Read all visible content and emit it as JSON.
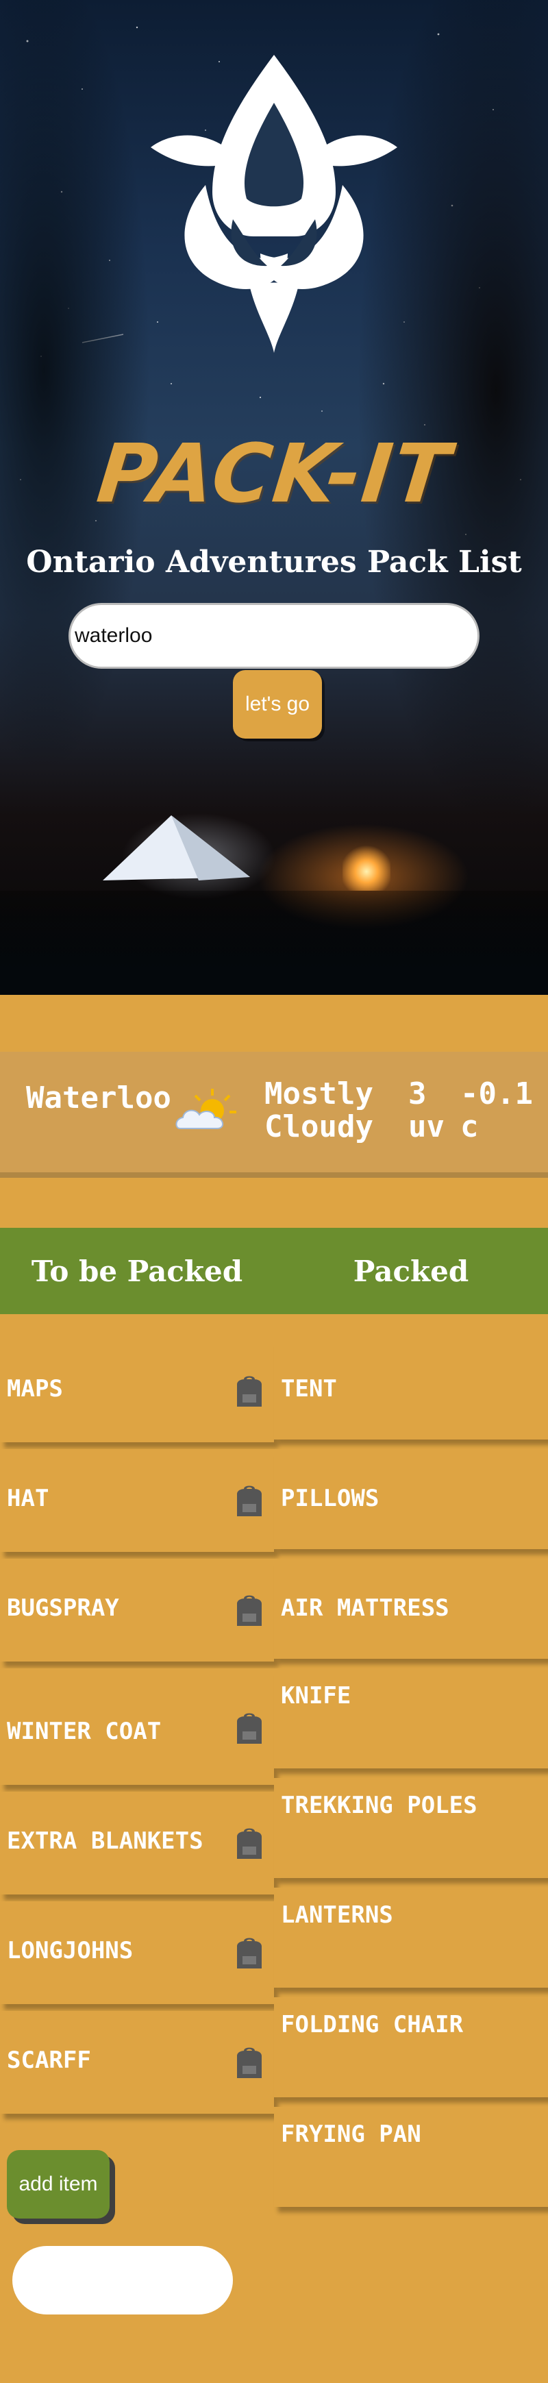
{
  "brand": {
    "name": "PACK-IT",
    "subtitle": "Ontario Adventures Pack List"
  },
  "search": {
    "value": "waterloo",
    "button_label": "let's go"
  },
  "weather": {
    "city": "Waterloo",
    "icon": "partly-cloudy-icon",
    "condition": "Mostly Cloudy",
    "uv": "3 uv",
    "temperature": "-0.1 c"
  },
  "tabs": [
    {
      "label": "To be Packed"
    },
    {
      "label": "Packed"
    }
  ],
  "to_be_packed": [
    {
      "label": "MAPS"
    },
    {
      "label": "HAT"
    },
    {
      "label": "BUGSPRAY"
    },
    {
      "label": "WINTER COAT"
    },
    {
      "label": "EXTRA BLANKETS"
    },
    {
      "label": "LONGJOHNS"
    },
    {
      "label": "SCARFF"
    }
  ],
  "packed": [
    {
      "label": "TENT"
    },
    {
      "label": "PILLOWS"
    },
    {
      "label": "AIR MATTRESS"
    },
    {
      "label": "KNIFE"
    },
    {
      "label": "TREKKING POLES"
    },
    {
      "label": "LANTERNS"
    },
    {
      "label": "FOLDING CHAIR"
    },
    {
      "label": "FRYING PAN"
    }
  ],
  "add": {
    "button_label": "add item",
    "input_value": ""
  },
  "colors": {
    "accent": "#DEA443",
    "green": "#6B8E2E",
    "weather_bg": "#D19F53"
  }
}
